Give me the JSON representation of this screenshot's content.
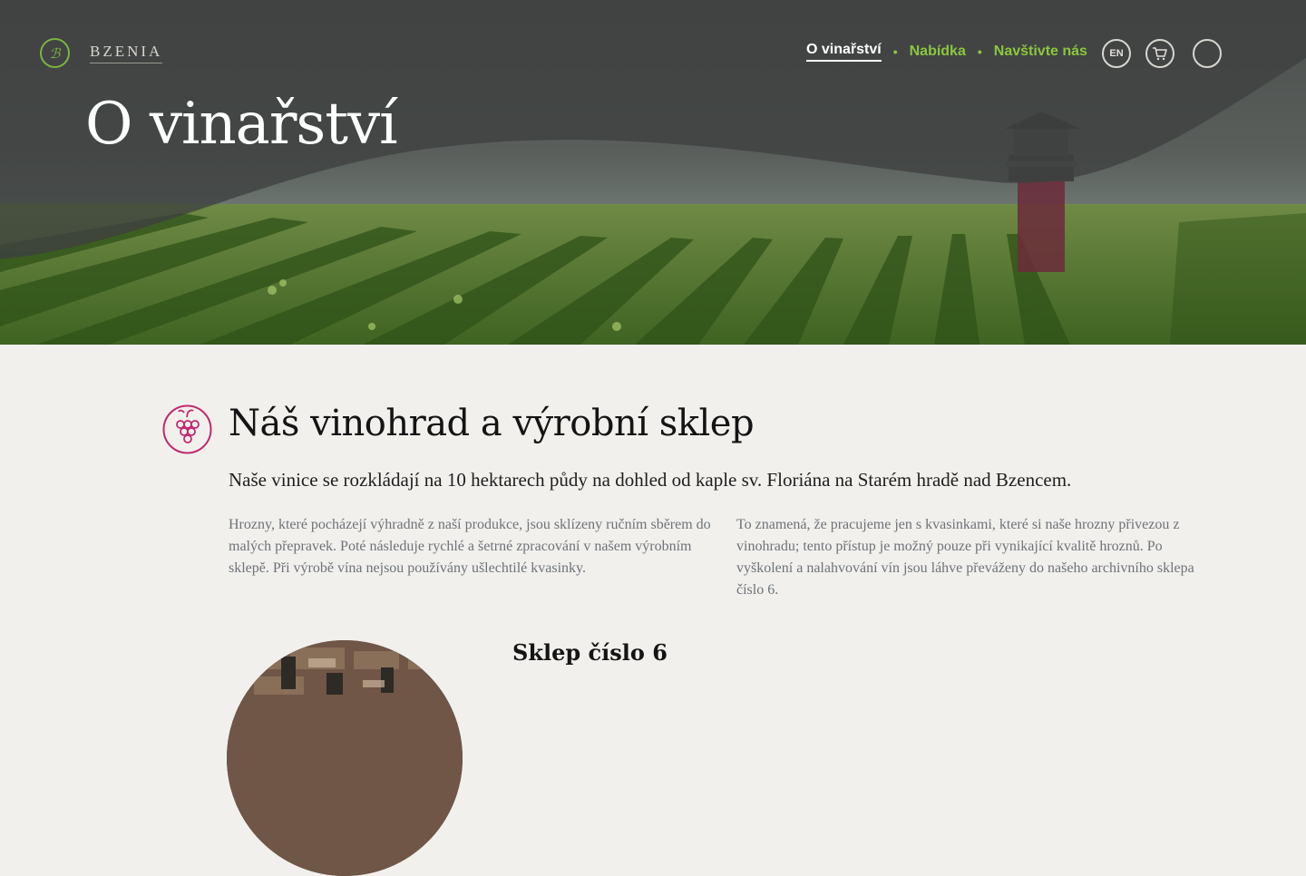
{
  "header": {
    "logo_mark": "ℬ",
    "brand": "BZENIA",
    "nav": [
      {
        "label": "O vinařství"
      },
      {
        "label": "Nabídka"
      },
      {
        "label": "Navštivte nás"
      }
    ],
    "nav_separator": "•",
    "lang_button": "EN"
  },
  "hero": {
    "title": "O vinařství"
  },
  "section": {
    "icon": "grapes-icon",
    "title": "Náš vinohrad a výrobní sklep",
    "lead": "Naše vinice se rozkládají na 10 hektarech půdy na dohled od kaple sv. Floriána na Starém hradě nad Bzencem.",
    "col_left": "Hrozny, které pocházejí výhradně z naší produkce, jsou sklízeny ručním sběrem do malých přepravek. Poté následuje rychlé a šetrné zpracování v našem výrobním sklepě. Při výrobě vína nejsou používány ušlechtilé kvasinky.",
    "col_right": "To znamená, že pracujeme jen s kvasinkami, které si naše hrozny přivezou z vinohradu; tento přístup je možný pouze při vynikající kvalitě hroznů. Po vyškolení a nalahvování vín jsou láhve převáženy do našeho archivního sklepa číslo 6."
  },
  "cellar": {
    "title": "Sklep číslo 6"
  },
  "colors": {
    "accent_green": "#8cc63f",
    "icon_magenta": "#c2296f",
    "background": "#f1f0ed"
  }
}
